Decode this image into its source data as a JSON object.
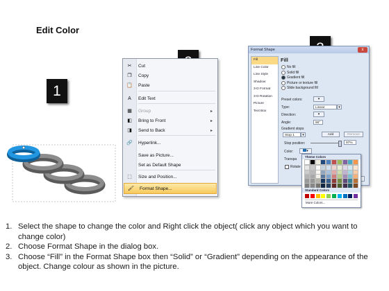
{
  "title": "Edit Color",
  "badges": [
    "1",
    "2",
    "3"
  ],
  "context_menu": {
    "items": [
      {
        "icon": "scissors-icon",
        "glyph": "✂",
        "label": "Cut",
        "sub": false,
        "disabled": false
      },
      {
        "icon": "copy-icon",
        "glyph": "❐",
        "label": "Copy",
        "sub": false,
        "disabled": false
      },
      {
        "icon": "paste-icon",
        "glyph": "📋",
        "label": "Paste",
        "sub": false,
        "disabled": false
      },
      {
        "icon": "edit-text-icon",
        "glyph": "A",
        "label": "Edit Text",
        "sub": false,
        "disabled": false
      },
      {
        "icon": "group-icon",
        "glyph": "▦",
        "label": "Group",
        "sub": true,
        "disabled": true
      },
      {
        "icon": "bring-to-front-icon",
        "glyph": "◧",
        "label": "Bring to Front",
        "sub": true,
        "disabled": false
      },
      {
        "icon": "send-to-back-icon",
        "glyph": "◨",
        "label": "Send to Back",
        "sub": true,
        "disabled": false
      },
      {
        "icon": "hyperlink-icon",
        "glyph": "🔗",
        "label": "Hyperlink...",
        "sub": false,
        "disabled": false
      },
      {
        "icon": "",
        "glyph": "",
        "label": "Save as Picture...",
        "sub": false,
        "disabled": false
      },
      {
        "icon": "",
        "glyph": "",
        "label": "Set as Default Shape",
        "sub": false,
        "disabled": false
      },
      {
        "icon": "size-position-icon",
        "glyph": "⬚",
        "label": "Size and Position...",
        "sub": false,
        "disabled": false
      },
      {
        "icon": "format-shape-icon",
        "glyph": "🖌",
        "label": "Format Shape...",
        "sub": false,
        "disabled": false,
        "highlighted": true
      }
    ]
  },
  "dialog": {
    "title": "Format Shape",
    "close": "x",
    "nav": [
      "Fill",
      "Line Color",
      "Line Style",
      "Shadow",
      "3-D Format",
      "3-D Rotation",
      "Picture",
      "Text Box"
    ],
    "heading": "Fill",
    "fill_options": [
      "No fill",
      "Solid fill",
      "Gradient fill",
      "Picture or texture fill",
      "Slide background fill"
    ],
    "selected_fill": "Gradient fill",
    "preset_label": "Preset colors:",
    "type_label": "Type:",
    "type_value": "Linear",
    "direction_label": "Direction:",
    "angle_label": "Angle:",
    "angle_value": "90°",
    "stops_label": "Gradient stops",
    "stop_value": "Stop 1",
    "add_label": "Add",
    "remove_label": "Remove",
    "stop_position_label": "Stop position:",
    "stop_position_value": "97%",
    "color_label": "Color:",
    "transparency_label": "Transpa",
    "rotate_label": "Rotate",
    "close_button": "Close"
  },
  "palette": {
    "theme_header": "Theme Colors",
    "standard_header": "Standard Colors",
    "more": "More Colors...",
    "theme_top": [
      "#ffffff",
      "#000000",
      "#eeece1",
      "#1f497d",
      "#4f81bd",
      "#c0504d",
      "#9bbb59",
      "#8064a2",
      "#4bacc6",
      "#f79646"
    ],
    "standard": [
      "#c00000",
      "#ff0000",
      "#ffc000",
      "#ffff00",
      "#92d050",
      "#00b050",
      "#00b0f0",
      "#0070c0",
      "#002060",
      "#7030a0"
    ]
  },
  "instructions": [
    {
      "num": "1.",
      "text": "Select the shape to change the color and Right click the object( click any object which you want to change color)"
    },
    {
      "num": "2.",
      "text": "Choose Format Shape in the dialog box."
    },
    {
      "num": "3.",
      "text": "Choose “Fill” in the Format Shape box then “Solid” or “Gradient” depending on the appearance of the object. Change colour as shown in the picture."
    }
  ],
  "colors": {
    "ring_accent": "#1a8ad4",
    "ring_gray": "#6e6e6e",
    "menu_highlight": "#f7c95c"
  }
}
